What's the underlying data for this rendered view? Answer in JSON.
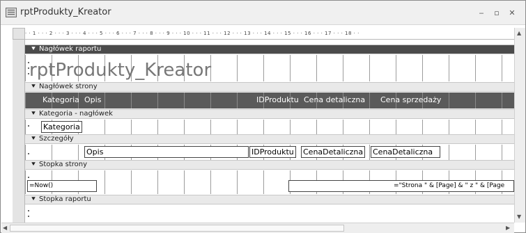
{
  "window": {
    "title": "rptProdukty_Kreator",
    "minimize": "‒",
    "restore": "▫",
    "close": "✕"
  },
  "ruler": {
    "text": "· · 1 · · · 2 · · · 3 · · · 4 · · · 5 · · · 6 · · · 7 · · · 8 · · · 9 · · · 10 · · · 11 · · · 12 · · · 13 · · · 14 · · · 15 · · · 16 · · · 17 · · · 18 · ·"
  },
  "sections": {
    "report_header": "Nagłówek raportu",
    "page_header": "Nagłówek strony",
    "group_header": "Kategoria - nagłówek",
    "detail": "Szczegóły",
    "page_footer": "Stopka strony",
    "report_footer": "Stopka raportu"
  },
  "report_header": {
    "title": "rptProdukty_Kreator"
  },
  "page_header": {
    "labels": [
      "Kategoria",
      "Opis",
      "IDProduktu",
      "Cena detaliczna",
      "Cena sprzedaży"
    ]
  },
  "group_header": {
    "field": "Kategoria"
  },
  "detail": {
    "fields": [
      "Opis",
      "IDProduktu",
      "CenaDetaliczna",
      "CenaDetaliczna"
    ]
  },
  "page_footer": {
    "date_expr": "=Now()",
    "page_expr": "=\"Strona \" & [Page] & \" z \" & [Page"
  },
  "icons": {
    "section_glyph": "collapse-arrow-icon",
    "scroll_up": "▲",
    "scroll_down": "▼",
    "scroll_left": "◀",
    "scroll_right": "▶"
  }
}
